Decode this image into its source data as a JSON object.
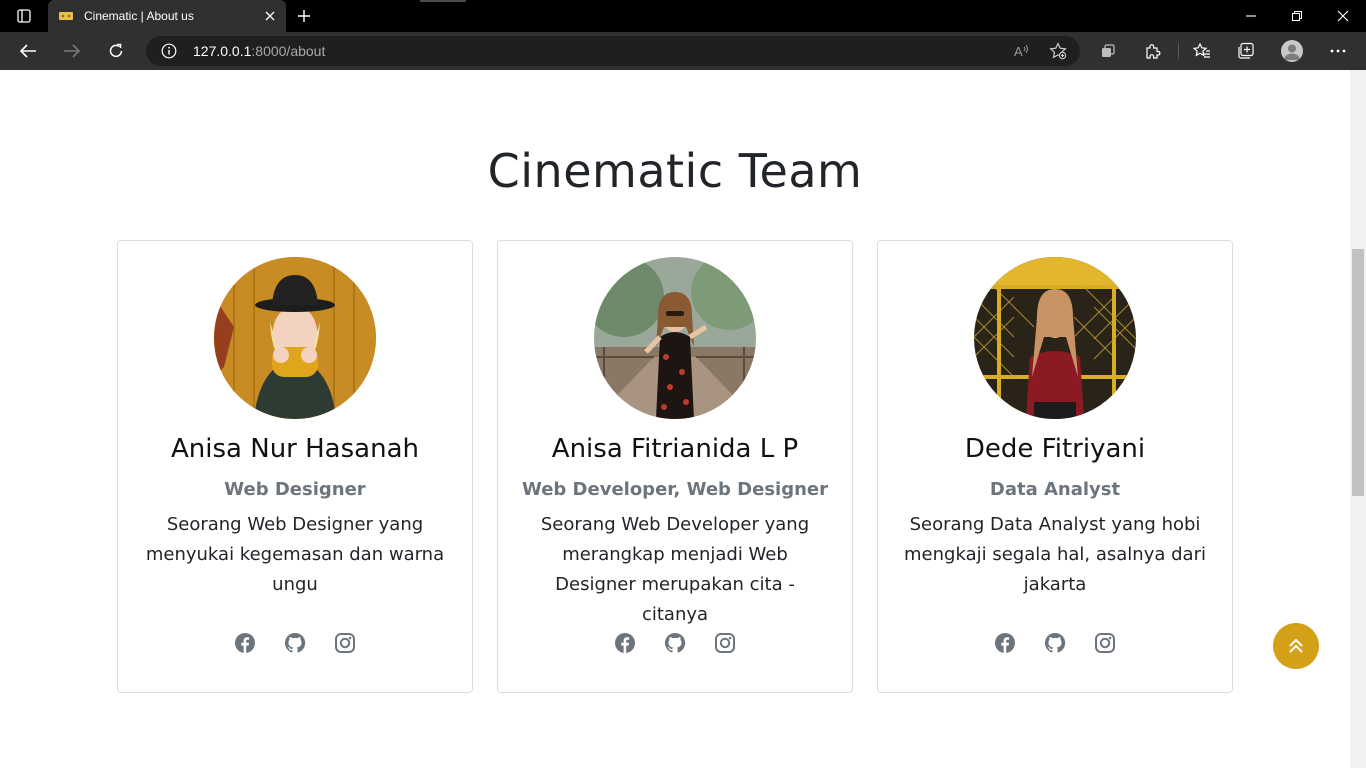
{
  "browser": {
    "tab_title": "Cinematic | About us",
    "url_host": "127.0.0.1",
    "url_rest": ":8000/about"
  },
  "page": {
    "title": "Cinematic Team",
    "accent_color": "#d4a017"
  },
  "team": [
    {
      "name": "Anisa Nur Hasanah",
      "role": "Web Designer",
      "description": "Seorang Web Designer yang menyukai kegemasan dan warna ungu",
      "icons": [
        "facebook-icon",
        "github-icon",
        "instagram-icon"
      ]
    },
    {
      "name": "Anisa Fitrianida L P",
      "role": "Web Developer, Web Designer",
      "description": "Seorang Web Developer yang merangkap menjadi Web Designer merupakan cita - citanya",
      "icons": [
        "facebook-icon",
        "github-icon",
        "instagram-icon"
      ]
    },
    {
      "name": "Dede Fitriyani",
      "role": "Data Analyst",
      "description": "Seorang Data Analyst yang hobi mengkaji segala hal, asalnya dari jakarta",
      "icons": [
        "facebook-icon",
        "github-icon",
        "instagram-icon"
      ]
    }
  ]
}
